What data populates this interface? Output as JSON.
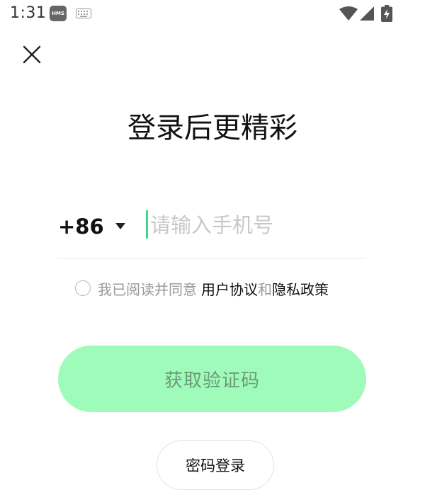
{
  "status_bar": {
    "time": "1:31",
    "hms_badge": "HMS",
    "icons": [
      "hms-icon",
      "keyboard-icon",
      "wifi-icon",
      "signal-icon",
      "battery-charging-icon"
    ]
  },
  "header": {
    "close_icon": "close-icon"
  },
  "title": "登录后更精彩",
  "phone": {
    "country_code": "+86",
    "value": "",
    "placeholder": "请输入手机号"
  },
  "agreement": {
    "prefix": "我已阅读并同意",
    "user_agreement": "用户协议",
    "and": "和",
    "privacy_policy": "隐私政策"
  },
  "actions": {
    "get_code_label": "获取验证码",
    "password_login_label": "密码登录"
  },
  "colors": {
    "accent_green": "#3ddc84",
    "button_green_disabled": "#9ffbba",
    "button_text_disabled": "#6c9a78",
    "hint_gray": "#999999"
  }
}
